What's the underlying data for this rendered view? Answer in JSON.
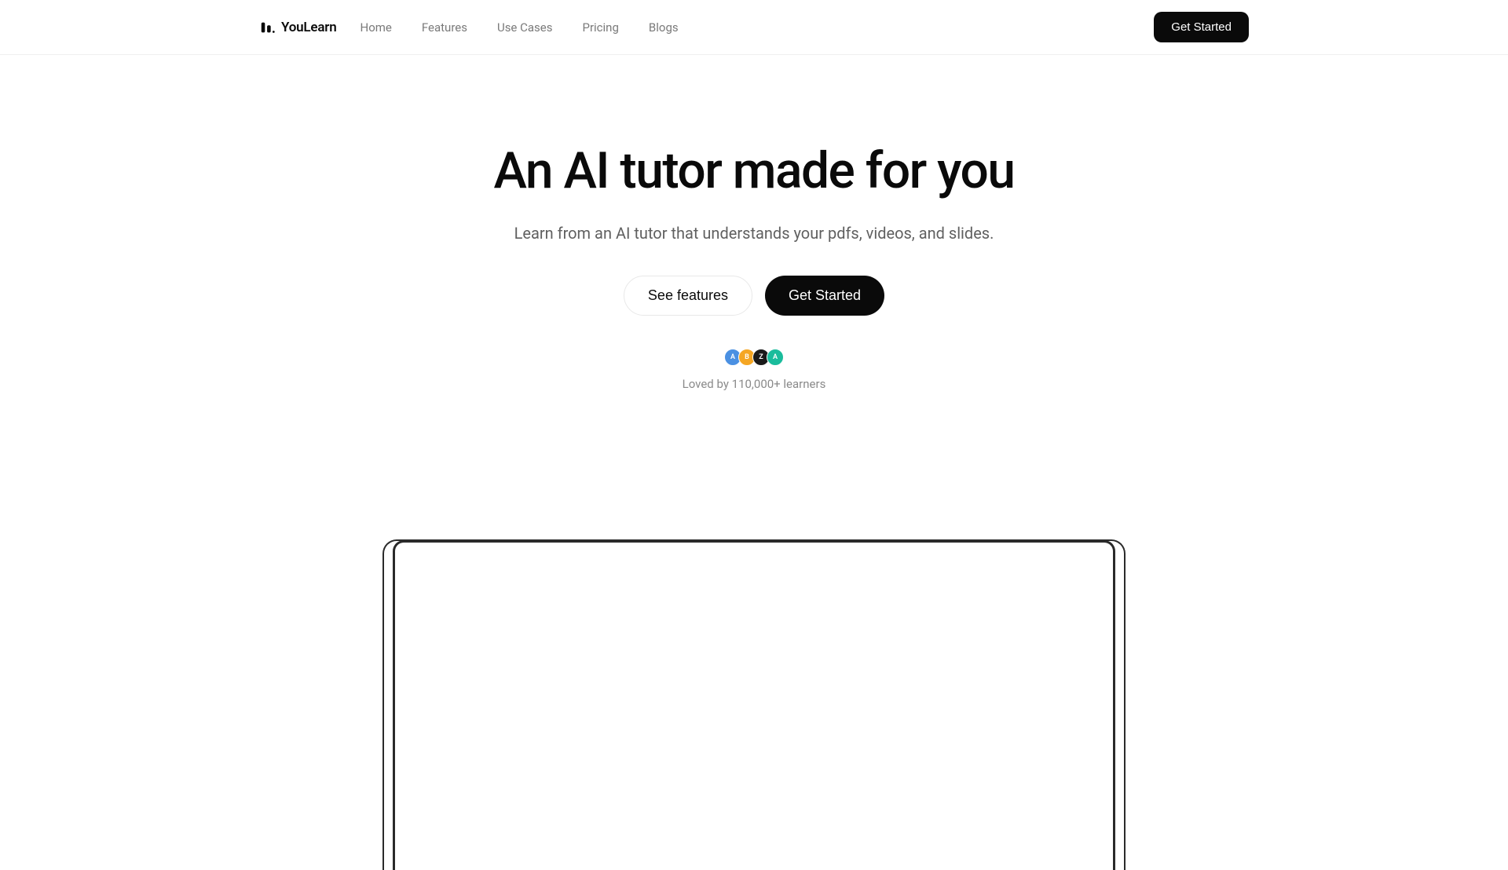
{
  "brand": {
    "name": "YouLearn"
  },
  "nav": {
    "links": [
      "Home",
      "Features",
      "Use Cases",
      "Pricing",
      "Blogs"
    ],
    "cta": "Get Started"
  },
  "hero": {
    "title": "An AI tutor made for you",
    "subtitle": "Learn from an AI tutor that understands your pdfs, videos, and slides.",
    "secondary_button": "See features",
    "primary_button": "Get Started"
  },
  "social": {
    "avatars": [
      "A",
      "B",
      "Z",
      "A"
    ],
    "text": "Loved by 110,000+ learners"
  }
}
